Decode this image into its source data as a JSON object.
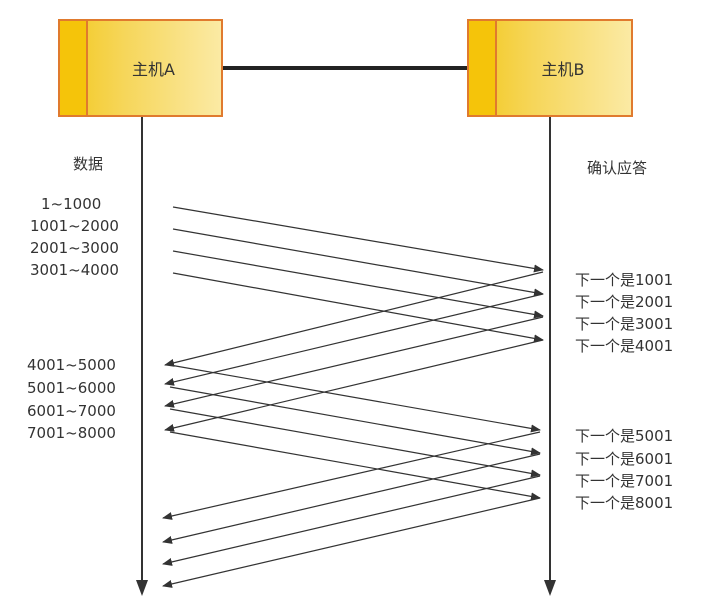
{
  "hosts": {
    "a": {
      "label": "主机A"
    },
    "b": {
      "label": "主机B"
    }
  },
  "labels": {
    "data_header": "数据",
    "ack_header": "确认应答"
  },
  "data_segments": [
    {
      "label": "1~1000"
    },
    {
      "label": "1001~2000"
    },
    {
      "label": "2001~3000"
    },
    {
      "label": "3001~4000"
    },
    {
      "label": "4001~5000"
    },
    {
      "label": "5001~6000"
    },
    {
      "label": "6001~7000"
    },
    {
      "label": "7001~8000"
    }
  ],
  "acks": [
    {
      "label": "下一个是1001"
    },
    {
      "label": "下一个是2001"
    },
    {
      "label": "下一个是3001"
    },
    {
      "label": "下一个是4001"
    },
    {
      "label": "下一个是5001"
    },
    {
      "label": "下一个是6001"
    },
    {
      "label": "下一个是7001"
    },
    {
      "label": "下一个是8001"
    }
  ],
  "colors": {
    "host_fill": "#f6d65a",
    "host_border": "#e07a2e",
    "line": "#333333"
  }
}
